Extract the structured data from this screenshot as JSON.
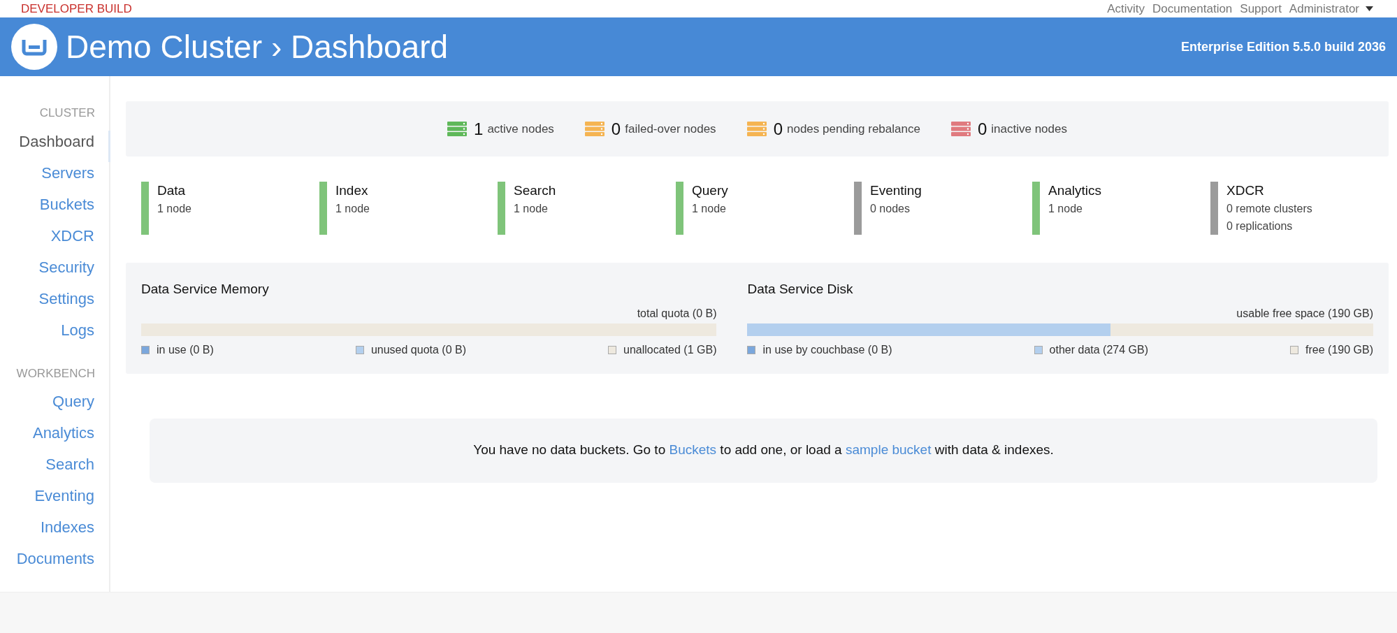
{
  "top_bar": {
    "build_label": "DEVELOPER BUILD",
    "links": [
      {
        "label": "Activity",
        "kind": "link"
      },
      {
        "label": "Documentation",
        "kind": "link"
      },
      {
        "label": "Support",
        "kind": "link"
      },
      {
        "label": "Administrator",
        "kind": "dropdown"
      }
    ]
  },
  "header": {
    "cluster": "Demo Cluster",
    "separator": "›",
    "page": "Dashboard",
    "edition": "Enterprise Edition 5.5.0 build 2036"
  },
  "sidebar": {
    "sections": [
      {
        "heading": "CLUSTER",
        "items": [
          {
            "label": "Dashboard",
            "selected": true
          },
          {
            "label": "Servers",
            "selected": false
          },
          {
            "label": "Buckets",
            "selected": false
          },
          {
            "label": "XDCR",
            "selected": false
          },
          {
            "label": "Security",
            "selected": false
          },
          {
            "label": "Settings",
            "selected": false
          },
          {
            "label": "Logs",
            "selected": false
          }
        ]
      },
      {
        "heading": "WORKBENCH",
        "items": [
          {
            "label": "Query",
            "selected": false
          },
          {
            "label": "Analytics",
            "selected": false
          },
          {
            "label": "Search",
            "selected": false
          },
          {
            "label": "Eventing",
            "selected": false
          },
          {
            "label": "Indexes",
            "selected": false
          },
          {
            "label": "Documents",
            "selected": false
          }
        ]
      }
    ]
  },
  "node_status": [
    {
      "count": "1",
      "label": "active nodes",
      "color": "#5fb85a"
    },
    {
      "count": "0",
      "label": "failed-over nodes",
      "color": "#f5b452"
    },
    {
      "count": "0",
      "label": "nodes pending rebalance",
      "color": "#f5b452"
    },
    {
      "count": "0",
      "label": "inactive nodes",
      "color": "#e07a7f"
    }
  ],
  "services": [
    {
      "name": "Data",
      "lines": [
        "1 node"
      ],
      "color": "#7fc47a"
    },
    {
      "name": "Index",
      "lines": [
        "1 node"
      ],
      "color": "#7fc47a"
    },
    {
      "name": "Search",
      "lines": [
        "1 node"
      ],
      "color": "#7fc47a"
    },
    {
      "name": "Query",
      "lines": [
        "1 node"
      ],
      "color": "#7fc47a"
    },
    {
      "name": "Eventing",
      "lines": [
        "0 nodes"
      ],
      "color": "#9b9b9b"
    },
    {
      "name": "Analytics",
      "lines": [
        "1 node"
      ],
      "color": "#7fc47a"
    },
    {
      "name": "XDCR",
      "lines": [
        "0 remote clusters",
        "0 replications"
      ],
      "color": "#9b9b9b"
    }
  ],
  "usage": [
    {
      "title": "Data Service Memory",
      "total": "total quota (0 B)",
      "level": 0,
      "segments": [
        {
          "label": "in use (0 B)",
          "color": "#7ba7dc"
        },
        {
          "label": "unused quota (0 B)",
          "color": "#b3cfee"
        },
        {
          "label": "unallocated (1 GB)",
          "color": "#eee9df"
        }
      ]
    },
    {
      "title": "Data Service Disk",
      "total": "usable free space (190 GB)",
      "level": 0.58,
      "segments": [
        {
          "label": "in use by couchbase (0 B)",
          "color": "#7ba7dc"
        },
        {
          "label": "other data (274 GB)",
          "color": "#b3cfee"
        },
        {
          "label": "free (190 GB)",
          "color": "#eee9df"
        }
      ]
    }
  ],
  "notice": {
    "parts": [
      {
        "text": "You have no data buckets. Go to",
        "kind": "text"
      },
      {
        "text": "Buckets",
        "kind": "link"
      },
      {
        "text": "to add one, or load a",
        "kind": "text"
      },
      {
        "text": "sample bucket",
        "kind": "link"
      },
      {
        "text": "with data & indexes.",
        "kind": "text"
      }
    ]
  }
}
